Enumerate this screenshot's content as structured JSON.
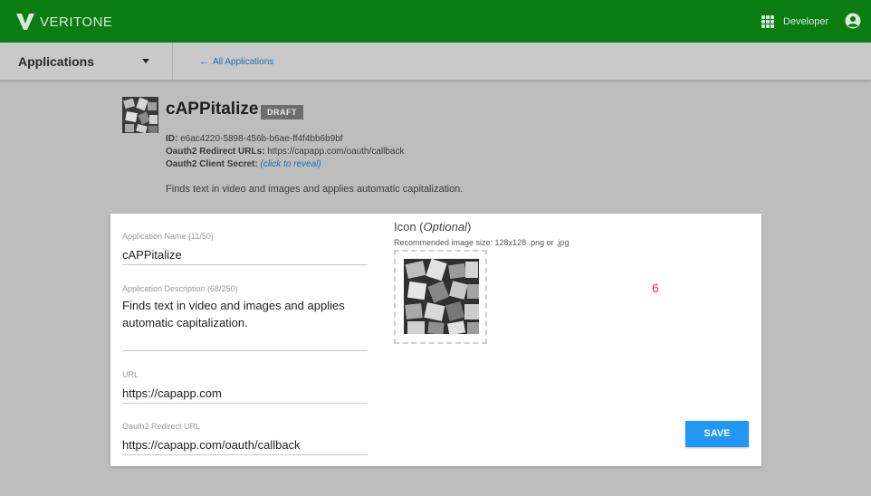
{
  "header": {
    "brand": "VERITONE",
    "apps_icon": "grid-icon",
    "user_label": "Developer",
    "account_icon": "account-circle-icon",
    "brand_color": "#0a7c12"
  },
  "subnav": {
    "dropdown_label": "Applications",
    "back_link": "All Applications"
  },
  "app": {
    "name": "cAPPitalize",
    "status_badge": "DRAFT",
    "id_label": "ID:",
    "id_value": "e6ac4220-5898-456b-b6ae-ff4f4bb6b9bf",
    "redirect_label": "Oauth2 Redirect URLs:",
    "redirect_value": "https://capapp.com/oauth/callback",
    "secret_label": "Oauth2 Client Secret:",
    "secret_action": "(click to reveal)",
    "description": "Finds text in video and images and applies automatic capitalization."
  },
  "form": {
    "name_label": "Application Name (11/50)",
    "name_value": "cAPPitalize",
    "description_label": "Application Description (68/250)",
    "description_value": "Finds text in video and images and applies automatic capitalization.",
    "url_label": "URL",
    "url_value": "https://capapp.com",
    "redirect_label": "Oauth2 Redirect URL",
    "redirect_value": "https://capapp.com/oauth/callback",
    "icon_heading": "Icon (",
    "icon_heading_optional": "Optional",
    "icon_heading_close": ")",
    "icon_hint": "Recommended image size: 128x128 .png or .jpg",
    "counter": "6",
    "save_label": "SAVE",
    "accent_color": "#2196f3"
  }
}
